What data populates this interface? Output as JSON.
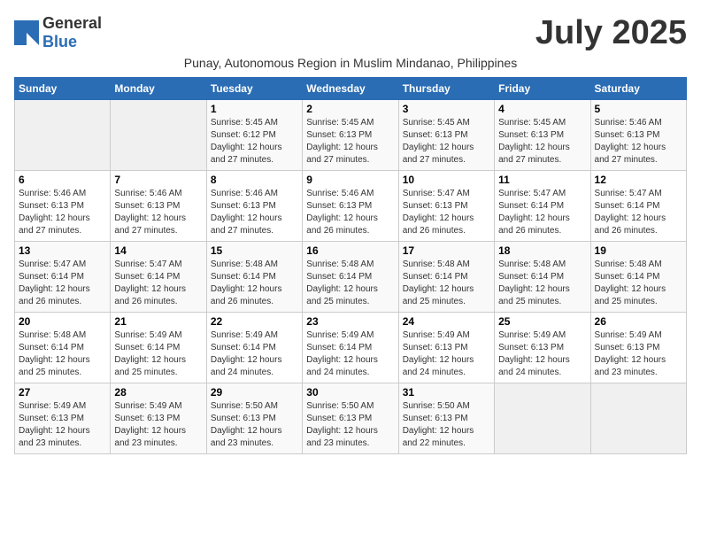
{
  "header": {
    "logo_general": "General",
    "logo_blue": "Blue",
    "month_title": "July 2025",
    "subtitle": "Punay, Autonomous Region in Muslim Mindanao, Philippines"
  },
  "weekdays": [
    "Sunday",
    "Monday",
    "Tuesday",
    "Wednesday",
    "Thursday",
    "Friday",
    "Saturday"
  ],
  "weeks": [
    [
      {
        "day": "",
        "info": ""
      },
      {
        "day": "",
        "info": ""
      },
      {
        "day": "1",
        "info": "Sunrise: 5:45 AM\nSunset: 6:12 PM\nDaylight: 12 hours and 27 minutes."
      },
      {
        "day": "2",
        "info": "Sunrise: 5:45 AM\nSunset: 6:13 PM\nDaylight: 12 hours and 27 minutes."
      },
      {
        "day": "3",
        "info": "Sunrise: 5:45 AM\nSunset: 6:13 PM\nDaylight: 12 hours and 27 minutes."
      },
      {
        "day": "4",
        "info": "Sunrise: 5:45 AM\nSunset: 6:13 PM\nDaylight: 12 hours and 27 minutes."
      },
      {
        "day": "5",
        "info": "Sunrise: 5:46 AM\nSunset: 6:13 PM\nDaylight: 12 hours and 27 minutes."
      }
    ],
    [
      {
        "day": "6",
        "info": "Sunrise: 5:46 AM\nSunset: 6:13 PM\nDaylight: 12 hours and 27 minutes."
      },
      {
        "day": "7",
        "info": "Sunrise: 5:46 AM\nSunset: 6:13 PM\nDaylight: 12 hours and 27 minutes."
      },
      {
        "day": "8",
        "info": "Sunrise: 5:46 AM\nSunset: 6:13 PM\nDaylight: 12 hours and 27 minutes."
      },
      {
        "day": "9",
        "info": "Sunrise: 5:46 AM\nSunset: 6:13 PM\nDaylight: 12 hours and 26 minutes."
      },
      {
        "day": "10",
        "info": "Sunrise: 5:47 AM\nSunset: 6:13 PM\nDaylight: 12 hours and 26 minutes."
      },
      {
        "day": "11",
        "info": "Sunrise: 5:47 AM\nSunset: 6:14 PM\nDaylight: 12 hours and 26 minutes."
      },
      {
        "day": "12",
        "info": "Sunrise: 5:47 AM\nSunset: 6:14 PM\nDaylight: 12 hours and 26 minutes."
      }
    ],
    [
      {
        "day": "13",
        "info": "Sunrise: 5:47 AM\nSunset: 6:14 PM\nDaylight: 12 hours and 26 minutes."
      },
      {
        "day": "14",
        "info": "Sunrise: 5:47 AM\nSunset: 6:14 PM\nDaylight: 12 hours and 26 minutes."
      },
      {
        "day": "15",
        "info": "Sunrise: 5:48 AM\nSunset: 6:14 PM\nDaylight: 12 hours and 26 minutes."
      },
      {
        "day": "16",
        "info": "Sunrise: 5:48 AM\nSunset: 6:14 PM\nDaylight: 12 hours and 25 minutes."
      },
      {
        "day": "17",
        "info": "Sunrise: 5:48 AM\nSunset: 6:14 PM\nDaylight: 12 hours and 25 minutes."
      },
      {
        "day": "18",
        "info": "Sunrise: 5:48 AM\nSunset: 6:14 PM\nDaylight: 12 hours and 25 minutes."
      },
      {
        "day": "19",
        "info": "Sunrise: 5:48 AM\nSunset: 6:14 PM\nDaylight: 12 hours and 25 minutes."
      }
    ],
    [
      {
        "day": "20",
        "info": "Sunrise: 5:48 AM\nSunset: 6:14 PM\nDaylight: 12 hours and 25 minutes."
      },
      {
        "day": "21",
        "info": "Sunrise: 5:49 AM\nSunset: 6:14 PM\nDaylight: 12 hours and 25 minutes."
      },
      {
        "day": "22",
        "info": "Sunrise: 5:49 AM\nSunset: 6:14 PM\nDaylight: 12 hours and 24 minutes."
      },
      {
        "day": "23",
        "info": "Sunrise: 5:49 AM\nSunset: 6:14 PM\nDaylight: 12 hours and 24 minutes."
      },
      {
        "day": "24",
        "info": "Sunrise: 5:49 AM\nSunset: 6:13 PM\nDaylight: 12 hours and 24 minutes."
      },
      {
        "day": "25",
        "info": "Sunrise: 5:49 AM\nSunset: 6:13 PM\nDaylight: 12 hours and 24 minutes."
      },
      {
        "day": "26",
        "info": "Sunrise: 5:49 AM\nSunset: 6:13 PM\nDaylight: 12 hours and 23 minutes."
      }
    ],
    [
      {
        "day": "27",
        "info": "Sunrise: 5:49 AM\nSunset: 6:13 PM\nDaylight: 12 hours and 23 minutes."
      },
      {
        "day": "28",
        "info": "Sunrise: 5:49 AM\nSunset: 6:13 PM\nDaylight: 12 hours and 23 minutes."
      },
      {
        "day": "29",
        "info": "Sunrise: 5:50 AM\nSunset: 6:13 PM\nDaylight: 12 hours and 23 minutes."
      },
      {
        "day": "30",
        "info": "Sunrise: 5:50 AM\nSunset: 6:13 PM\nDaylight: 12 hours and 23 minutes."
      },
      {
        "day": "31",
        "info": "Sunrise: 5:50 AM\nSunset: 6:13 PM\nDaylight: 12 hours and 22 minutes."
      },
      {
        "day": "",
        "info": ""
      },
      {
        "day": "",
        "info": ""
      }
    ]
  ]
}
